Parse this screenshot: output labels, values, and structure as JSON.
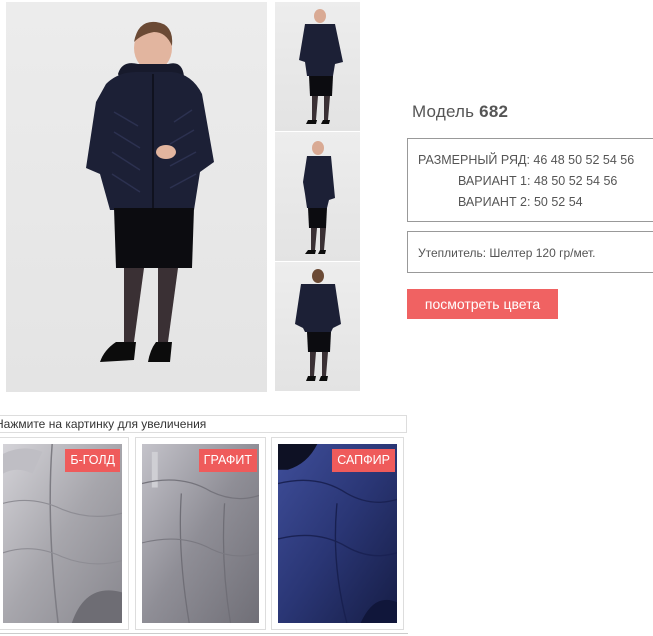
{
  "model": {
    "prefix": "Модель",
    "number": "682"
  },
  "sizes": {
    "line1": "РАЗМЕРНЫЙ РЯД: 46 48 50 52 54 56",
    "line2": "ВАРИАНТ 1: 48 50 52 54 56",
    "line3": "ВАРИАНТ 2: 50 52 54"
  },
  "insulation": "Утеплитель: Шелтер 120 гр/мет.",
  "colors_button_label": "посмотреть цвета",
  "zoom_hint": "Нажмите на картинку для увеличения",
  "swatches": [
    {
      "label": "Б-ГОЛД",
      "color": "#a7a6ac"
    },
    {
      "label": "ГРАФИТ",
      "color": "#8f8e96"
    },
    {
      "label": "САПФИР",
      "color": "#2a3675"
    }
  ],
  "colors": {
    "accent": "#f06262",
    "jacket": "#1c2036",
    "text": "#555555"
  }
}
